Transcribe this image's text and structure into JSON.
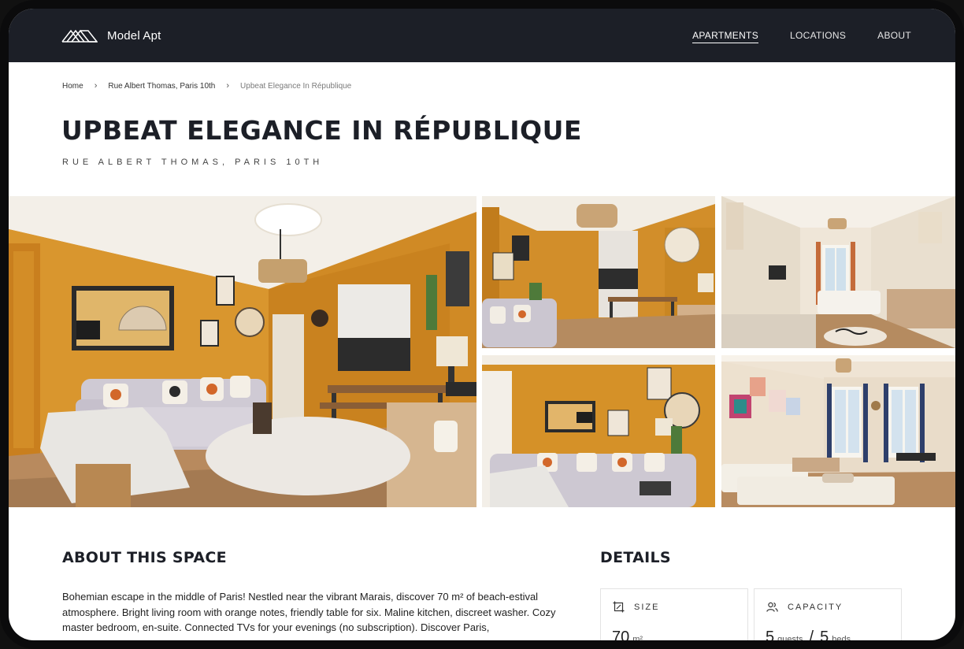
{
  "brand": {
    "name": "Model Apt",
    "logo_icon": "mountains-logo-icon"
  },
  "nav": {
    "items": [
      {
        "label": "APARTMENTS",
        "active": true
      },
      {
        "label": "LOCATIONS",
        "active": false
      },
      {
        "label": "ABOUT",
        "active": false
      }
    ]
  },
  "breadcrumb": {
    "items": [
      "Home",
      "Rue Albert Thomas, Paris 10th",
      "Upbeat Elegance In République"
    ],
    "separator": "›"
  },
  "listing": {
    "title": "UPBEAT ELEGANCE IN RÉPUBLIQUE",
    "subtitle": "RUE ALBERT THOMAS, PARIS 10TH"
  },
  "gallery": {
    "photos": [
      "living-room-main",
      "living-dining",
      "bedroom-long",
      "living-sofa-wall",
      "bedroom-windows"
    ]
  },
  "about": {
    "heading": "ABOUT THIS SPACE",
    "text": "Bohemian escape in the middle of Paris! Nestled near the vibrant Marais, discover 70 m² of beach-estival atmosphere. Bright living room with orange notes, friendly table for six. Maline kitchen, discreet washer. Cozy master bedroom, en-suite. Connected TVs for your evenings (no subscription). Discover Paris,"
  },
  "details": {
    "heading": "DETAILS",
    "size": {
      "label": "SIZE",
      "value": "70",
      "unit": "m²",
      "icon": "size-icon"
    },
    "capacity": {
      "label": "CAPACITY",
      "guests": "5",
      "guests_unit": "guests",
      "separator": "/",
      "beds": "5",
      "beds_unit": "beds",
      "icon": "people-icon"
    }
  },
  "colors": {
    "nav_bg": "#1c1f27",
    "accent_wall": "#d9962e",
    "text_dark": "#1c1f27"
  }
}
